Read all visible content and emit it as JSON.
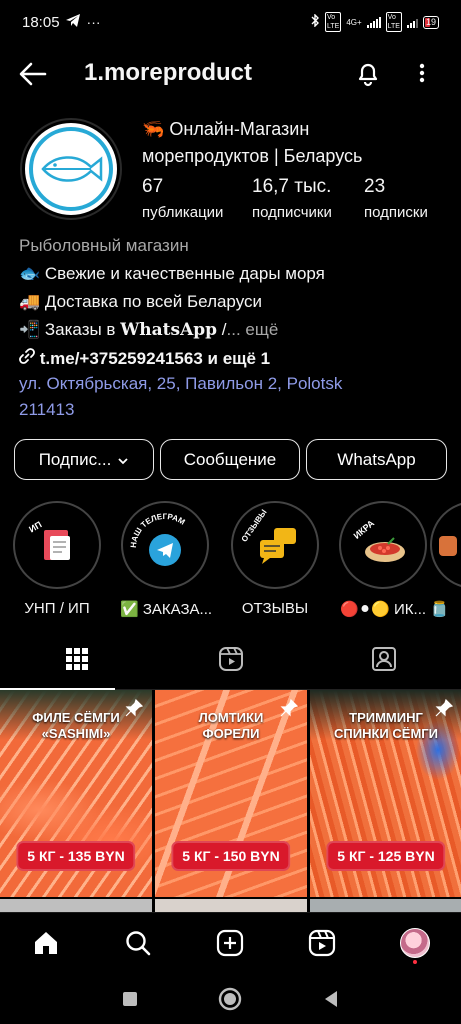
{
  "status": {
    "time": "18:05",
    "battery": "19",
    "network": "4G+"
  },
  "header": {
    "username": "1.moreproduct"
  },
  "profile": {
    "name_line1": "🦐 Онлайн-Магазин",
    "name_line2": "морепродуктов  | Беларусь",
    "stats": [
      {
        "value": "67",
        "label": "публикации"
      },
      {
        "value": "16,7 тыс.",
        "label": "подписчики"
      },
      {
        "value": "23",
        "label": "подписки"
      }
    ]
  },
  "bio": {
    "category": "Рыболовный магазин",
    "line1": "🐟 Свежие и качественные дары моря",
    "line2": "🚚 Доставка по всей Беларуси",
    "line3_prefix": "📲 Заказы в ",
    "line3_bold": "WhatsApp",
    "line3_suffix": " /",
    "more": "... ещё",
    "link": "t.me/+375259241563 и ещё 1",
    "address_line1": "ул. Октябрьская, 25, Павильон 2, Polotsk",
    "address_line2": "211413"
  },
  "buttons": {
    "follow": "Подпис...",
    "message": "Сообщение",
    "whatsapp": "WhatsApp"
  },
  "highlights": [
    {
      "label": "УНП / ИП",
      "badge": "ИП"
    },
    {
      "label": "✅ ЗАКАЗА...",
      "badge": "НАШ ТЕЛЕГРАМ"
    },
    {
      "label": "ОТЗЫВЫ",
      "badge": "ОТЗЫВЫ"
    },
    {
      "label": "🔴⚫🟡 ИК...",
      "badge": "ИКРА"
    },
    {
      "label": "🫙"
    }
  ],
  "posts": [
    {
      "title_line1": "ФИЛЕ СЁМГИ",
      "title_line2": "«SASHIMI»",
      "price": "5 КГ - 135 BYN"
    },
    {
      "title_line1": "ЛОМТИКИ",
      "title_line2": "ФОРЕЛИ",
      "price": "5 КГ - 150 BYN"
    },
    {
      "title_line1": "ТРИММИНГ",
      "title_line2": "СПИНКИ СЁМГИ",
      "price": "5 КГ - 125 BYN"
    }
  ],
  "colors": {
    "accent_link": "#8f9be8",
    "price_red": "#d9192b",
    "background": "#000000"
  }
}
